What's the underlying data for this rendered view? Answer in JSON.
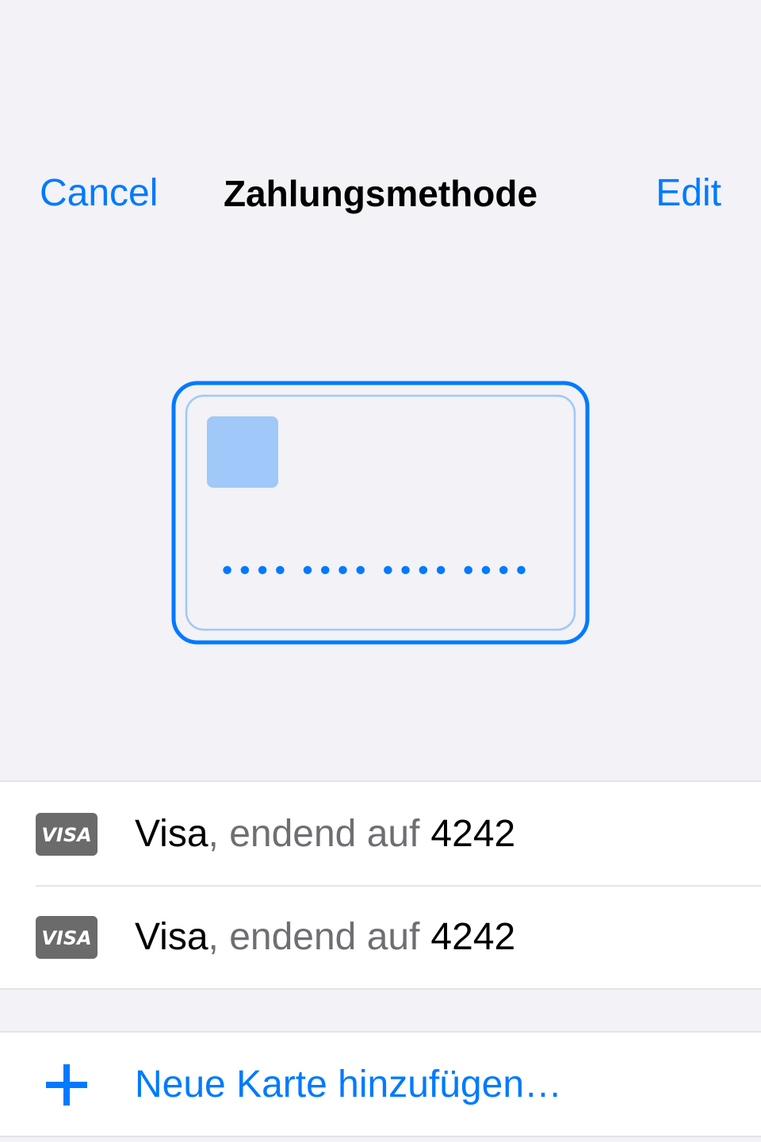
{
  "nav": {
    "cancel_label": "Cancel",
    "title": "Zahlungsmethode",
    "edit_label": "Edit"
  },
  "card_illustration": {
    "icon": "credit-card-icon",
    "masked_number": "•••• •••• •••• ••••"
  },
  "payment_methods": [
    {
      "brand_icon": "visa-logo",
      "badge_text": "VISA",
      "brand": "Visa",
      "connector": ", endend auf",
      "last4": "4242"
    },
    {
      "brand_icon": "visa-logo",
      "badge_text": "VISA",
      "brand": "Visa",
      "connector": ", endend auf",
      "last4": "4242"
    }
  ],
  "add_card": {
    "icon": "plus-icon",
    "label": "Neue Karte hinzufügen…"
  },
  "colors": {
    "accent": "#007aff",
    "background": "#f2f2f7",
    "secondary_text": "#6e6e73",
    "visa_badge": "#6b6b6b"
  }
}
